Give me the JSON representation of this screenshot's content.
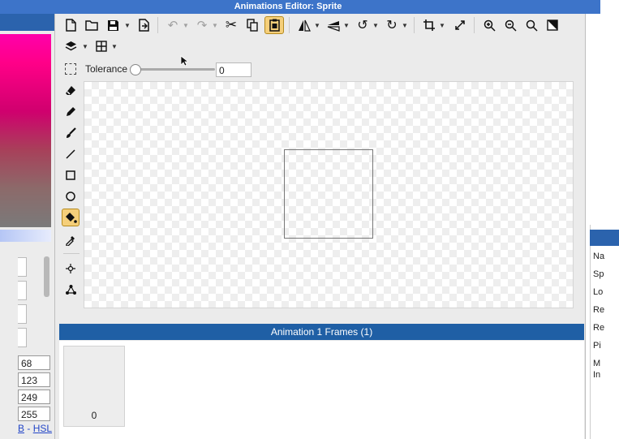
{
  "window": {
    "title": "Animations Editor: Sprite"
  },
  "toolbar_icons": [
    "new-file-icon",
    "open-folder-icon",
    "save-icon",
    "export-icon",
    "undo-icon",
    "redo-icon",
    "cut-icon",
    "copy-icon",
    "paste-icon",
    "flip-horizontal-icon",
    "flip-vertical-icon",
    "rotate-ccw-icon",
    "rotate-cw-icon",
    "crop-icon",
    "resize-icon",
    "zoom-in-icon",
    "zoom-out-icon",
    "zoom-fit-icon",
    "invert-icon",
    "layers-icon",
    "grid-icon"
  ],
  "tolerance": {
    "label": "Tolerance",
    "value": "0",
    "slider_level": 0
  },
  "side_tools": [
    "eraser-icon",
    "pencil-icon",
    "brush-icon",
    "line-icon",
    "rectangle-icon",
    "ellipse-icon",
    "fill-bucket-icon",
    "eyedropper-icon",
    "move-point-icon",
    "node-graph-icon"
  ],
  "active_tools": [
    "paste-icon",
    "fill-bucket-icon"
  ],
  "color_panel": {
    "values": [
      "68",
      "123",
      "249",
      "255"
    ],
    "mode_links": {
      "rgb_fragment": "B",
      "separator": " - ",
      "hsl": "HSL"
    }
  },
  "properties_panel": {
    "labels": [
      "Na",
      "Sp",
      "Lo",
      "Re",
      "Re",
      "Pi",
      "M",
      "In"
    ]
  },
  "frames": {
    "header": "Animation 1 Frames (1)",
    "items": [
      {
        "label": "0"
      }
    ]
  },
  "colors": {
    "accent": "#1f5fa5",
    "titlebar": "#3d74c9",
    "active_tool": "#f5cf7a"
  }
}
